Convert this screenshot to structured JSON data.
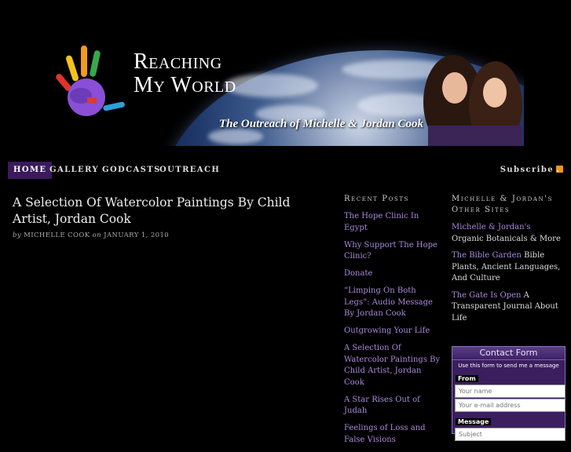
{
  "banner": {
    "title_line1": "Reaching",
    "title_line2": "My World",
    "tagline": "The Outreach of Michelle & Jordan Cook"
  },
  "nav": {
    "items": [
      "Home",
      "Gallery",
      "Godcasts",
      "Outreach"
    ],
    "active": "Home",
    "subscribe": "Subscribe"
  },
  "post": {
    "title": "A Selection Of Watercolor Paintings By Child Artist, Jordan Cook",
    "by": "by",
    "author": "Michelle Cook",
    "on": "on",
    "date": "January 1, 2010"
  },
  "recent_posts": {
    "heading": "Recent Posts",
    "items": [
      "The Hope Clinic In Egypt",
      "Why Support The Hope Clinic?",
      "Donate",
      "“Limping On Both Legs”: Audio Message By Jordan Cook",
      "Outgrowing Your Life",
      "A Selection Of Watercolor Paintings By Child Artist, Jordan Cook",
      "A Star Rises Out of Judah",
      "Feelings of Loss and False Visions"
    ]
  },
  "other_sites": {
    "heading": "Michelle & Jordan's Other Sites",
    "items": [
      {
        "link": "Michelle & Jordan's",
        "text": " Organic Botanicals & More"
      },
      {
        "link": "The Bible Garden",
        "text": " Bible Plants, Ancient Languages, And Culture"
      },
      {
        "link": "The Gate Is Open",
        "text": " A Transparent Journal About Life"
      }
    ]
  },
  "contact": {
    "title": "Contact Form",
    "note": "Use this form to send me a message",
    "from_label": "From",
    "name_placeholder": "Your name",
    "email_placeholder": "Your e-mail address",
    "message_label": "Message",
    "subject_placeholder": "Subject"
  },
  "colors": {
    "background": "#000000",
    "link": "#a98bdc",
    "nav_active": "#3a1a5c",
    "contact_bg": "#3a1e5e"
  }
}
